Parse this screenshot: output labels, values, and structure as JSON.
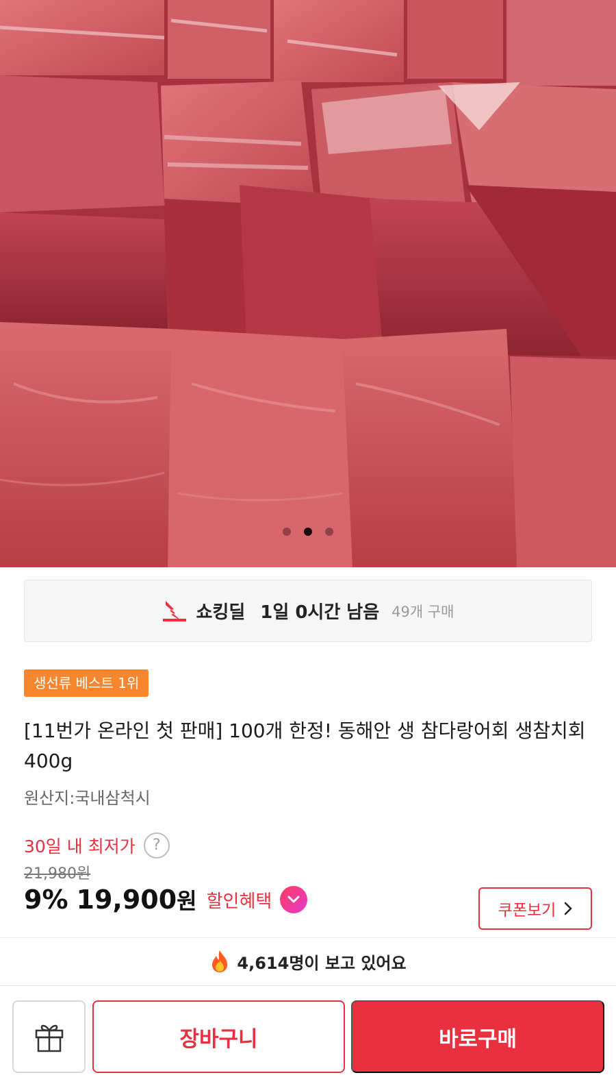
{
  "carousel": {
    "slide_count": 3,
    "active_index": 1
  },
  "deal": {
    "label": "쇼킹딜",
    "time_left": "1일 0시간 남음",
    "purchase_count": "49개 구매"
  },
  "badge": {
    "text": "생선류 베스트 1위"
  },
  "product": {
    "title": "[11번가 온라인 첫 판매] 100개 한정! 동해안 생 참다랑어회 생참치회 400g",
    "origin": "원산지:국내삼척시"
  },
  "pricing": {
    "lowest_label": "30일 내 최저가",
    "help_symbol": "?",
    "original_price": "21,980원",
    "discount": "9%",
    "price": "19,900",
    "currency": "원",
    "benefit_label": "할인혜택",
    "coupon_label": "쿠폰보기",
    "accent_color": "#e8303f"
  },
  "viewers": {
    "text": "4,614명이 보고 있어요",
    "icon": "fire-icon"
  },
  "bottom_bar": {
    "gift_icon": "gift-icon",
    "cart_label": "장바구니",
    "buy_label": "바로구매"
  }
}
